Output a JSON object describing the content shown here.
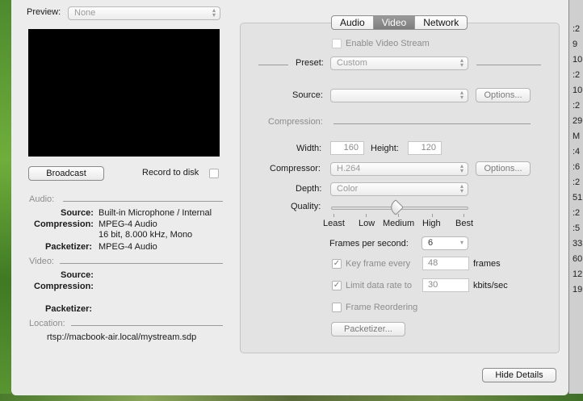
{
  "background_right_chars": [
    ":2",
    "9",
    "10",
    ":2",
    "10",
    ":2",
    "29",
    "M",
    ":4",
    ":6",
    ":2",
    "51",
    ":2",
    ":5",
    "33",
    "60",
    "12",
    "19"
  ],
  "preview": {
    "label": "Preview:",
    "value": "None"
  },
  "broadcast_button": "Broadcast",
  "record_to_disk": "Record to disk",
  "audio_section": {
    "header": "Audio:",
    "source_label": "Source:",
    "source_value": "Built-in Microphone / Internal",
    "compression_label": "Compression:",
    "compression_value_1": "MPEG-4 Audio",
    "compression_value_2": "16 bit, 8.000 kHz, Mono",
    "packetizer_label": "Packetizer:",
    "packetizer_value": "MPEG-4 Audio"
  },
  "video_section": {
    "header": "Video:",
    "source_label": "Source:",
    "compression_label": "Compression:",
    "packetizer_label": "Packetizer:"
  },
  "location": {
    "header": "Location:",
    "url": "rtsp://macbook-air.local/mystream.sdp"
  },
  "tabs": [
    {
      "label": "Audio",
      "selected": false
    },
    {
      "label": "Video",
      "selected": true
    },
    {
      "label": "Network",
      "selected": false
    }
  ],
  "video_tab": {
    "enable_video_stream": "Enable Video Stream",
    "preset_label": "Preset:",
    "preset_value": "Custom",
    "source_label": "Source:",
    "source_value": "",
    "options_label": "Options...",
    "compression_header": "Compression:",
    "width_label": "Width:",
    "width_value": "160",
    "height_label": "Height:",
    "height_value": "120",
    "compressor_label": "Compressor:",
    "compressor_value": "H.264",
    "compressor_options_label": "Options...",
    "depth_label": "Depth:",
    "depth_value": "Color",
    "quality_label": "Quality:",
    "quality_ticks": [
      "Least",
      "Low",
      "Medium",
      "High",
      "Best"
    ],
    "quality_level": "Medium",
    "fps_label": "Frames per second:",
    "fps_value": "6",
    "key_frame_label": "Key frame every",
    "key_frame_value": "48",
    "key_frame_unit": "frames",
    "limit_rate_label": "Limit data rate to",
    "limit_rate_value": "30",
    "limit_rate_unit": "kbits/sec",
    "frame_reordering": "Frame Reordering",
    "packetizer_button": "Packetizer..."
  },
  "hide_details_button": "Hide Details",
  "colors": {
    "window_bg": "#ececec",
    "panel_bg": "#e3e3e3",
    "selected_tab": "#7d7d7d"
  }
}
